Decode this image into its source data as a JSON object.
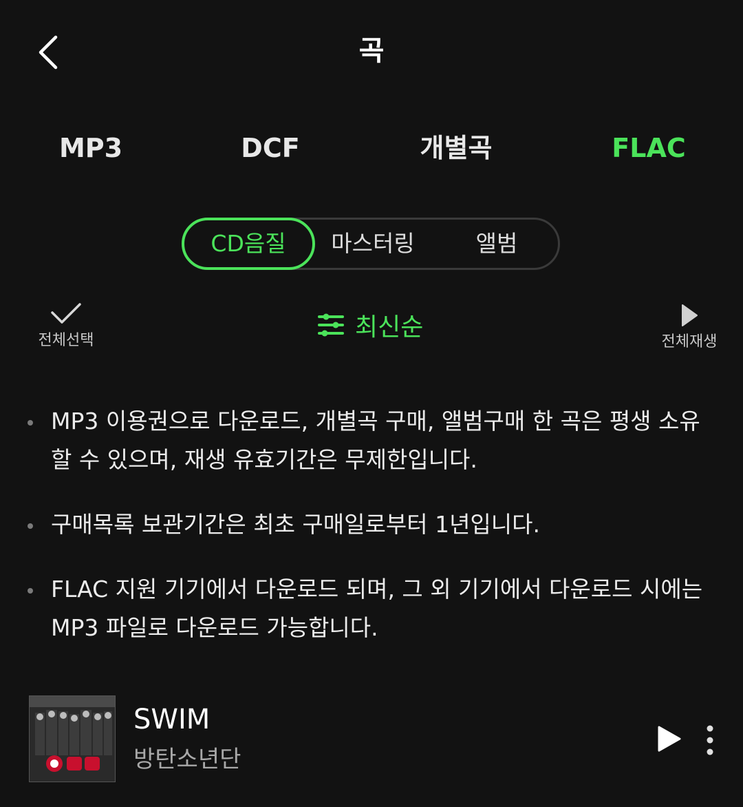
{
  "header": {
    "title": "곡"
  },
  "format_tabs": [
    {
      "label": "MP3",
      "active": false
    },
    {
      "label": "DCF",
      "active": false
    },
    {
      "label": "개별곡",
      "active": false
    },
    {
      "label": "FLAC",
      "active": true
    }
  ],
  "quality_segment": [
    {
      "label": "CD음질",
      "active": true
    },
    {
      "label": "마스터링",
      "active": false
    },
    {
      "label": "앨범",
      "active": false
    }
  ],
  "toolbar": {
    "select_all_label": "전체선택",
    "sort_label": "최신순",
    "play_all_label": "전체재생"
  },
  "notices": [
    "MP3 이용권으로 다운로드, 개별곡 구매, 앨범구매 한 곡은 평생 소유할 수 있으며, 재생 유효기간은 무제한입니다.",
    "구매목록 보관기간은 최초 구매일로부터 1년입니다.",
    "FLAC 지원 기기에서 다운로드 되며, 그 외 기기에서 다운로드 시에는 MP3 파일로 다운로드 가능합니다."
  ],
  "tracks": [
    {
      "title": "SWIM",
      "artist": "방탄소년단"
    }
  ],
  "colors": {
    "background": "#121212",
    "accent": "#4be35a",
    "text": "#ffffff",
    "muted": "#a8a8a8"
  },
  "icons": {
    "back": "chevron-left-icon",
    "select_all": "check-icon",
    "sort": "sliders-icon",
    "play_all": "play-icon",
    "more": "more-vertical-icon"
  }
}
